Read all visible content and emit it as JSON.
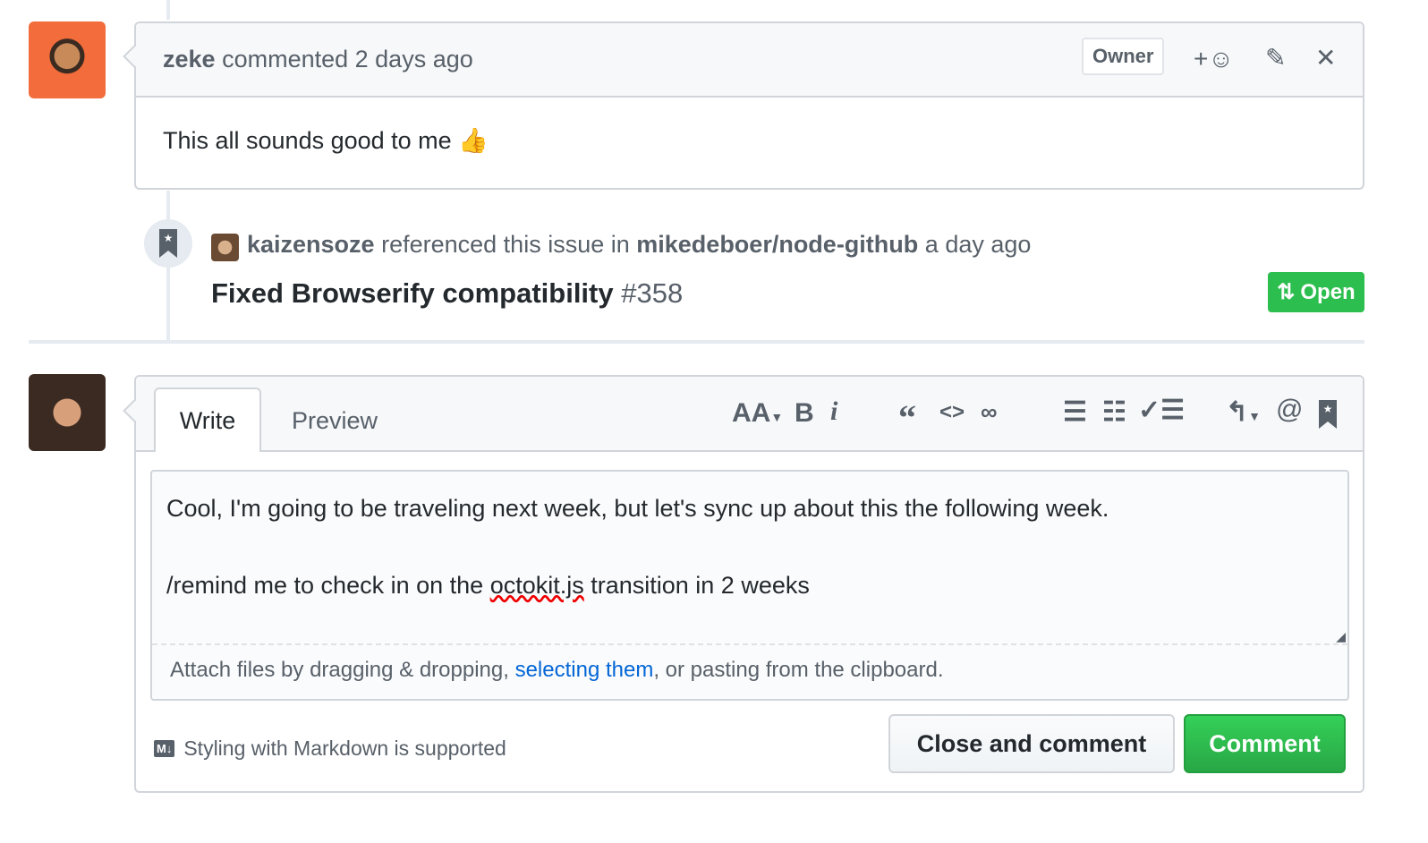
{
  "comment": {
    "author": "zeke",
    "action": "commented 2 days ago",
    "badge": "Owner",
    "body": "This all sounds good to me",
    "emoji": "👍",
    "add_reaction": "+"
  },
  "event": {
    "actor": "kaizensoze",
    "text1": "referenced this issue in",
    "repo": "mikedeboer/node-github",
    "time": "a day ago",
    "pr_title": "Fixed Browserify compatibility",
    "pr_number": "#358",
    "state": "Open"
  },
  "editor": {
    "tabs": [
      "Write",
      "Preview"
    ],
    "toolbar": {
      "heading": "AA",
      "bold": "B",
      "italic": "i",
      "quote": "“",
      "code": "<>",
      "link": "link-icon",
      "ul": "list-unordered-icon",
      "ol": "list-ordered-icon",
      "task": "tasklist-icon",
      "reply": "reply-icon",
      "mention": "@",
      "ref": "bookmark-icon"
    },
    "text_line1": "Cool, I'm going to be traveling next week, but let's sync up about this the following week.",
    "text_line2_pre": "/remind me to check in on the ",
    "text_line2_misspelled": "octokit.js",
    "text_line2_post": " transition in 2 weeks",
    "attach_pre": "Attach files by dragging & dropping, ",
    "attach_link": "selecting them",
    "attach_post": ", or pasting from the clipboard.",
    "markdown_icon": "M↓",
    "markdown_note": "Styling with Markdown is supported",
    "close_button": "Close and comment",
    "comment_button": "Comment"
  },
  "colors": {
    "green": "#28a745",
    "green_dark": "#2cbe4e",
    "link": "#0366d6"
  }
}
